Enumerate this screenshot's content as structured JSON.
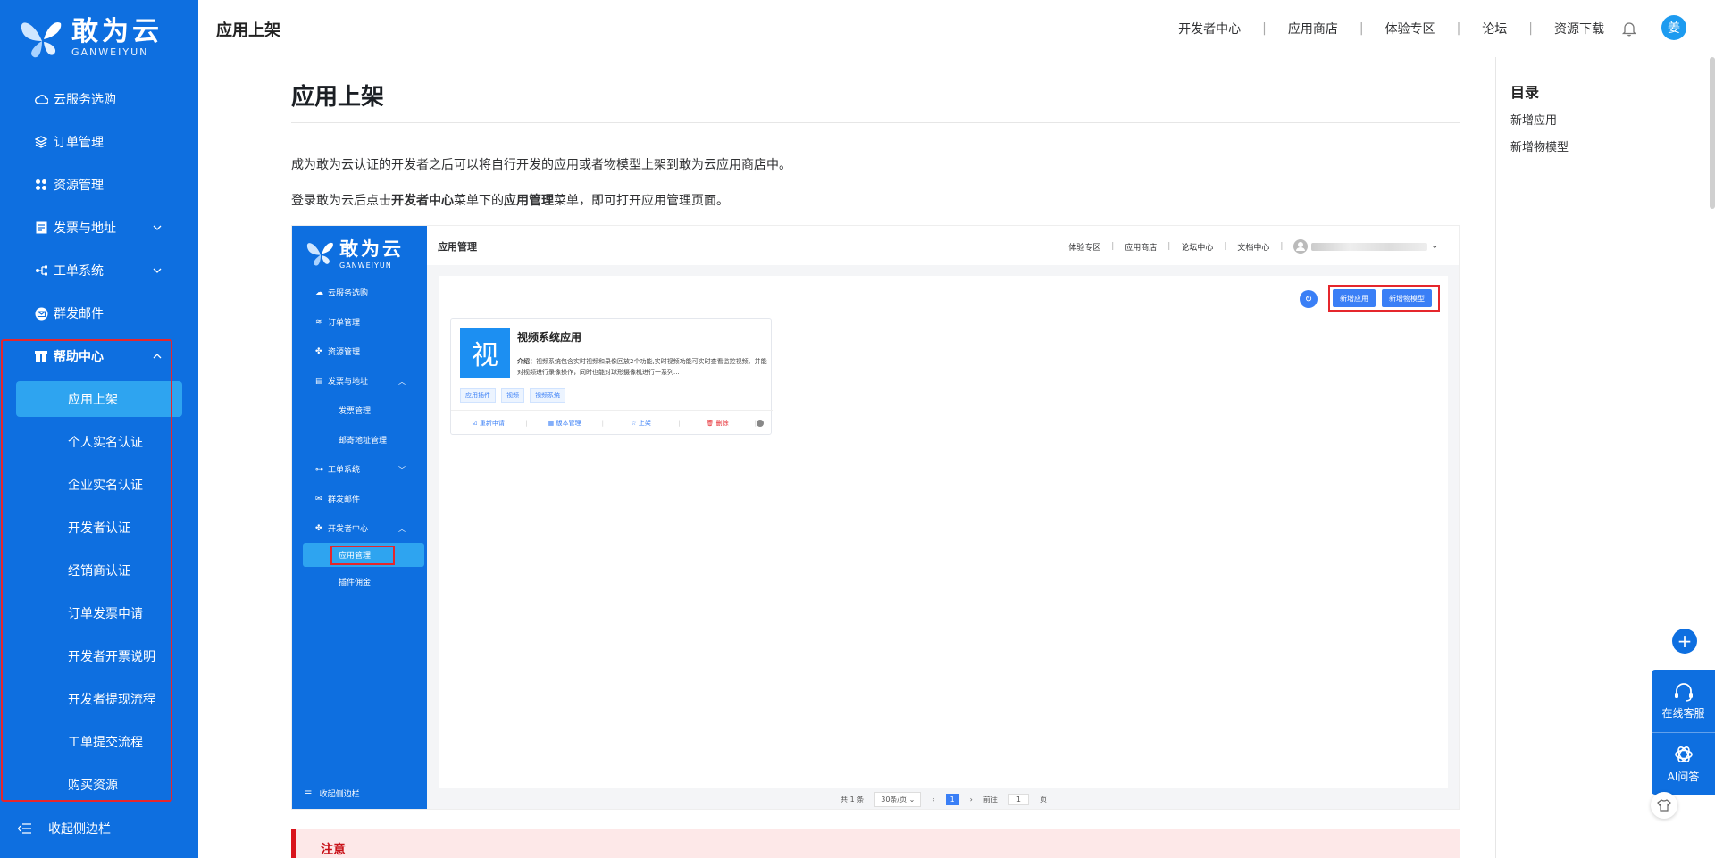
{
  "brand": {
    "name_cn": "敢为云",
    "name_en": "GANWEIYUN"
  },
  "sidebar": {
    "items": [
      {
        "label": "云服务选购",
        "icon": "cloud-icon"
      },
      {
        "label": "订单管理",
        "icon": "layers-icon"
      },
      {
        "label": "资源管理",
        "icon": "grid-icon"
      },
      {
        "label": "发票与地址",
        "icon": "invoice-icon"
      },
      {
        "label": "工单系统",
        "icon": "ticket-icon"
      },
      {
        "label": "群发邮件",
        "icon": "mail-icon"
      },
      {
        "label": "帮助中心",
        "icon": "help-icon"
      }
    ],
    "help_children": [
      "应用上架",
      "个人实名认证",
      "企业实名认证",
      "开发者认证",
      "经销商认证",
      "订单发票申请",
      "开发者开票说明",
      "开发者提现流程",
      "工单提交流程",
      "购买资源"
    ],
    "active_child": "应用上架",
    "collapse_label": "收起侧边栏"
  },
  "header": {
    "title": "应用上架",
    "links": [
      "开发者中心",
      "应用商店",
      "体验专区",
      "论坛",
      "资源下载"
    ],
    "avatar_text": "姜"
  },
  "doc": {
    "title": "应用上架",
    "para1": "成为敢为云认证的开发者之后可以将自行开发的应用或者物模型上架到敢为云应用商店中。",
    "para2_a": "登录敢为云后点击",
    "para2_b": "开发者中心",
    "para2_c": "菜单下的",
    "para2_d": "应用管理",
    "para2_e": "菜单，即可打开应用管理页面。",
    "notice_title": "注意"
  },
  "shot": {
    "brand_cn": "敢为云",
    "brand_en": "GANWEIYUN",
    "nav": [
      {
        "label": "云服务选购",
        "chev": ""
      },
      {
        "label": "订单管理",
        "chev": ""
      },
      {
        "label": "资源管理",
        "chev": ""
      },
      {
        "label": "发票与地址",
        "chev": "︿"
      },
      {
        "sub": "发票管理"
      },
      {
        "sub": "邮寄地址管理"
      },
      {
        "label": "工单系统",
        "chev": "﹀"
      },
      {
        "label": "群发邮件",
        "chev": ""
      },
      {
        "label": "开发者中心",
        "chev": "︿"
      }
    ],
    "active_sub": "应用管理",
    "sub_after": "插件佣金",
    "collapse": "收起侧边栏",
    "title": "应用管理",
    "links": [
      "体验专区",
      "应用商店",
      "论坛中心",
      "文档中心"
    ],
    "btn_new_app": "新增应用",
    "btn_new_model": "新增物模型",
    "card": {
      "icon_char": "视",
      "title": "视频系统应用",
      "desc_label": "介绍：",
      "desc": "视频系统包含实时视频和录像回放2个功能,实时视频功能可实时查看监控视频、并能对视频进行录像操作，同时也能对球形摄像机进行一系列...",
      "tags": [
        "应用插件",
        "视频",
        "视频系统"
      ],
      "actions": [
        "重新申请",
        "版本管理",
        "上架",
        "删除"
      ]
    },
    "pager": {
      "total": "共 1 条",
      "size": "30条/页",
      "current": "1",
      "goto": "前往",
      "page_input": "1",
      "page_unit": "页"
    }
  },
  "toc": {
    "title": "目录",
    "items": [
      "新增应用",
      "新增物模型"
    ]
  },
  "float": {
    "service": "在线客服",
    "ai": "AI问答"
  }
}
